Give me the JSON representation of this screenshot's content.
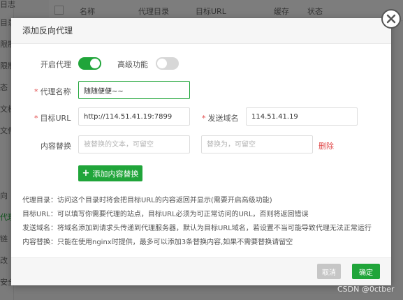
{
  "background": {
    "columns": [
      "名称",
      "代理目录",
      "目标URL",
      "缓存",
      "状态"
    ],
    "sidebar_items": [
      "日志",
      "目录",
      "限制",
      "限制",
      "态",
      "文档",
      "文件",
      "向",
      "代理",
      "链",
      "改",
      "安全"
    ]
  },
  "modal": {
    "title": "添加反向代理",
    "close_icon": "close-icon",
    "enable_proxy_label": "开启代理",
    "enable_proxy_on": true,
    "advanced_label": "高级功能",
    "advanced_on": false,
    "proxy_name_label": "代理名称",
    "proxy_name_value": "随随便便~~",
    "target_url_label": "目标URL",
    "target_url_value": "http://114.51.41.19:7899",
    "send_domain_label": "发送域名",
    "send_domain_value": "114.51.41.19",
    "content_replace_label": "内容替换",
    "replace_from_placeholder": "被替换的文本，可留空",
    "replace_to_placeholder": "替换为，可留空",
    "delete_label": "删除",
    "add_replace_label": "添加内容替换",
    "help": [
      "代理目录：访问这个目录时将会把目标URL的内容返回并显示(需要开启高级功能)",
      "目标URL：可以填写你需要代理的站点，目标URL必须为可正常访问的URL，否则将返回错误",
      "发送域名：将域名添加到请求头传递到代理服务器，默认为目标URL域名，若设置不当可能导致代理无法正常运行",
      "内容替换：只能在使用nginx时提供，最多可以添加3条替换内容,如果不需要替换请留空"
    ],
    "cancel_label": "取消",
    "ok_label": "确定"
  },
  "colors": {
    "accent": "#20a53a",
    "danger": "#e04a4a"
  },
  "watermark": "CSDN @0ctber"
}
